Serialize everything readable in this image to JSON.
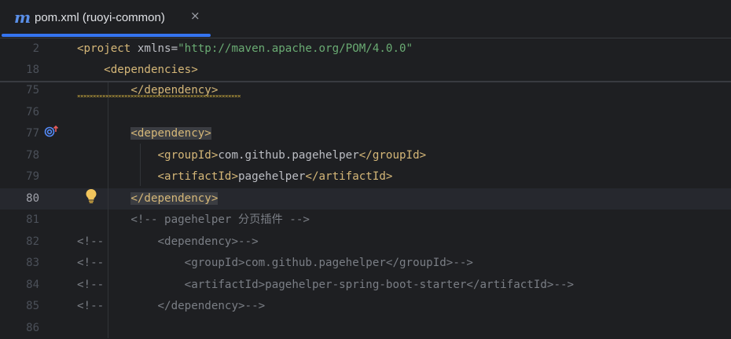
{
  "tab": {
    "icon": "maven-icon",
    "icon_glyph": "m",
    "title": "pom.xml (ruoyi-common)",
    "close": "×"
  },
  "sticky_lines": [
    {
      "n": "2",
      "segs": [
        {
          "c": "tag",
          "t": "<project "
        },
        {
          "c": "attr",
          "t": "xmlns="
        },
        {
          "c": "str",
          "t": "\"http://maven.apache.org/POM/4.0.0\""
        }
      ]
    },
    {
      "n": "18",
      "segs": [
        {
          "c": "txt",
          "t": "    "
        },
        {
          "c": "tag",
          "t": "<dependencies>"
        }
      ]
    }
  ],
  "lines": [
    {
      "n": "75",
      "segs": [
        {
          "c": "txt",
          "t": "        "
        },
        {
          "c": "tag",
          "t": "</dependency>"
        }
      ]
    },
    {
      "n": "76",
      "segs": []
    },
    {
      "n": "77",
      "segs": [
        {
          "c": "txt",
          "t": "        "
        },
        {
          "c": "tag hl",
          "t": "<dependency>"
        }
      ]
    },
    {
      "n": "78",
      "segs": [
        {
          "c": "txt",
          "t": "            "
        },
        {
          "c": "tag",
          "t": "<groupId>"
        },
        {
          "c": "txt",
          "t": "com.github.pagehelper"
        },
        {
          "c": "tag",
          "t": "</groupId>"
        }
      ]
    },
    {
      "n": "79",
      "segs": [
        {
          "c": "txt",
          "t": "            "
        },
        {
          "c": "tag",
          "t": "<artifactId>"
        },
        {
          "c": "txt",
          "t": "pagehelper"
        },
        {
          "c": "tag",
          "t": "</artifactId>"
        }
      ]
    },
    {
      "n": "80",
      "current": true,
      "segs": [
        {
          "c": "txt",
          "t": "        "
        },
        {
          "c": "tag hl",
          "t": "</dependency>"
        }
      ]
    },
    {
      "n": "81",
      "segs": [
        {
          "c": "txt",
          "t": "        "
        },
        {
          "c": "cmt",
          "t": "<!-- pagehelper 分页插件 -->"
        }
      ]
    },
    {
      "n": "82",
      "segs": [
        {
          "c": "cmt",
          "t": "<!--        <dependency>-->"
        }
      ]
    },
    {
      "n": "83",
      "segs": [
        {
          "c": "cmt",
          "t": "<!--            <groupId>com.github.pagehelper</groupId>-->"
        }
      ]
    },
    {
      "n": "84",
      "segs": [
        {
          "c": "cmt",
          "t": "<!--            <artifactId>pagehelper-spring-boot-starter</artifactId>-->"
        }
      ]
    },
    {
      "n": "85",
      "segs": [
        {
          "c": "cmt",
          "t": "<!--        </dependency>-->"
        }
      ]
    },
    {
      "n": "86",
      "segs": []
    }
  ],
  "gutter_icons": {
    "line_77": "implementation-overrides-icon",
    "line_80": "lightbulb-icon"
  },
  "colors": {
    "background": "#1e1f22",
    "tag": "#d5b778",
    "string": "#6aab73",
    "comment": "#7a7e85",
    "text": "#bcbec4",
    "accent": "#3574f0"
  }
}
